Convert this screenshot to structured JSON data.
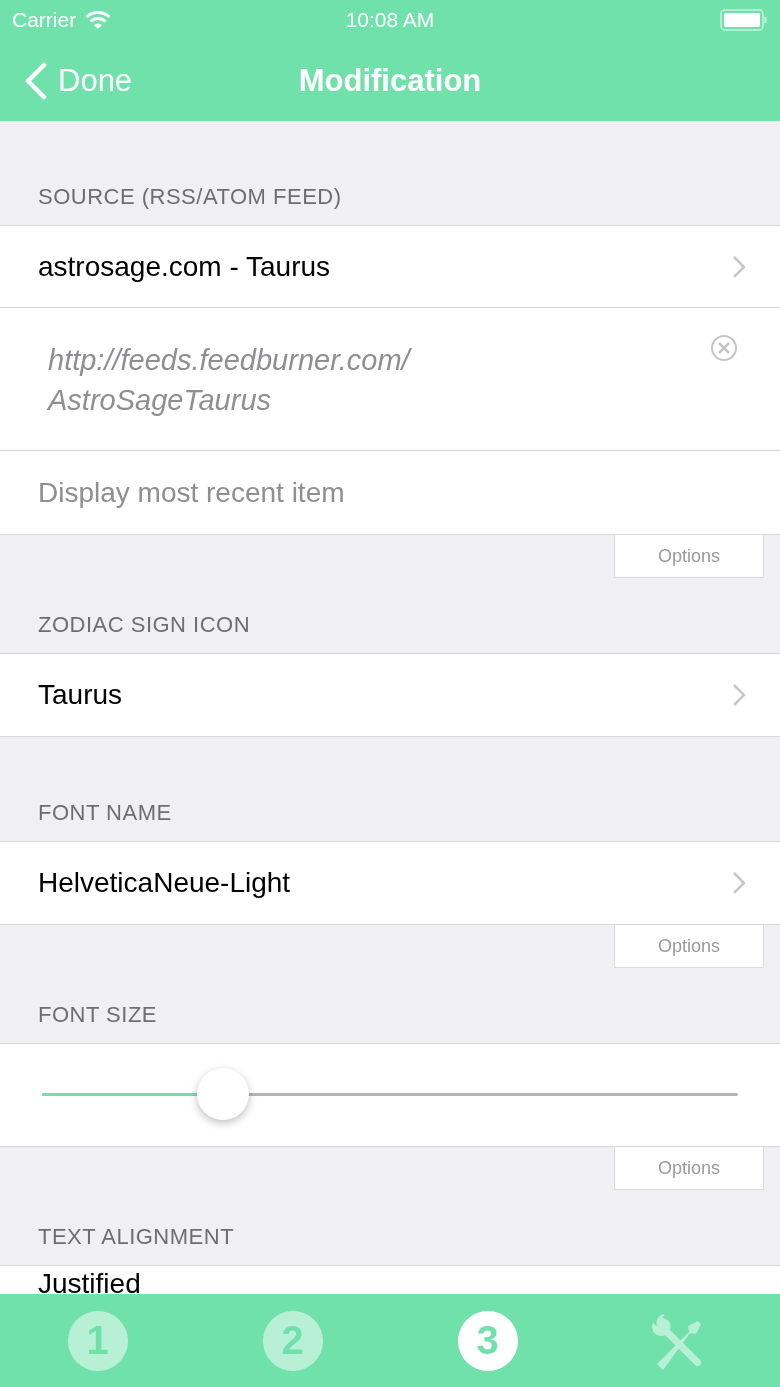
{
  "status_bar": {
    "carrier": "Carrier",
    "time": "10:08 AM"
  },
  "nav": {
    "back": "Done",
    "title": "Modification"
  },
  "sections": [
    {
      "header": "SOURCE (RSS/ATOM FEED)",
      "rows": [
        {
          "kind": "link",
          "text": "astrosage.com - Taurus"
        },
        {
          "kind": "url",
          "value": "http://feeds.feedburner.com/ AstroSageTaurus"
        },
        {
          "kind": "note",
          "text": "Display most recent item"
        }
      ],
      "options": "Options"
    },
    {
      "header": "ZODIAC SIGN ICON",
      "rows": [
        {
          "kind": "link",
          "text": "Taurus"
        }
      ]
    },
    {
      "header": "FONT NAME",
      "rows": [
        {
          "kind": "link",
          "text": "HelveticaNeue-Light"
        }
      ],
      "options": "Options"
    },
    {
      "header": "FONT SIZE",
      "rows": [
        {
          "kind": "slider",
          "level": 0.26
        }
      ],
      "options": "Options"
    },
    {
      "header": "TEXT ALIGNMENT",
      "rows": [
        {
          "kind": "cut",
          "text": "Justified"
        }
      ]
    }
  ],
  "tabs": [
    {
      "kind": "number",
      "label": "1",
      "selected": false
    },
    {
      "kind": "number",
      "label": "2",
      "selected": false
    },
    {
      "kind": "number",
      "label": "3",
      "selected": true
    },
    {
      "kind": "tools",
      "selected": false
    }
  ]
}
